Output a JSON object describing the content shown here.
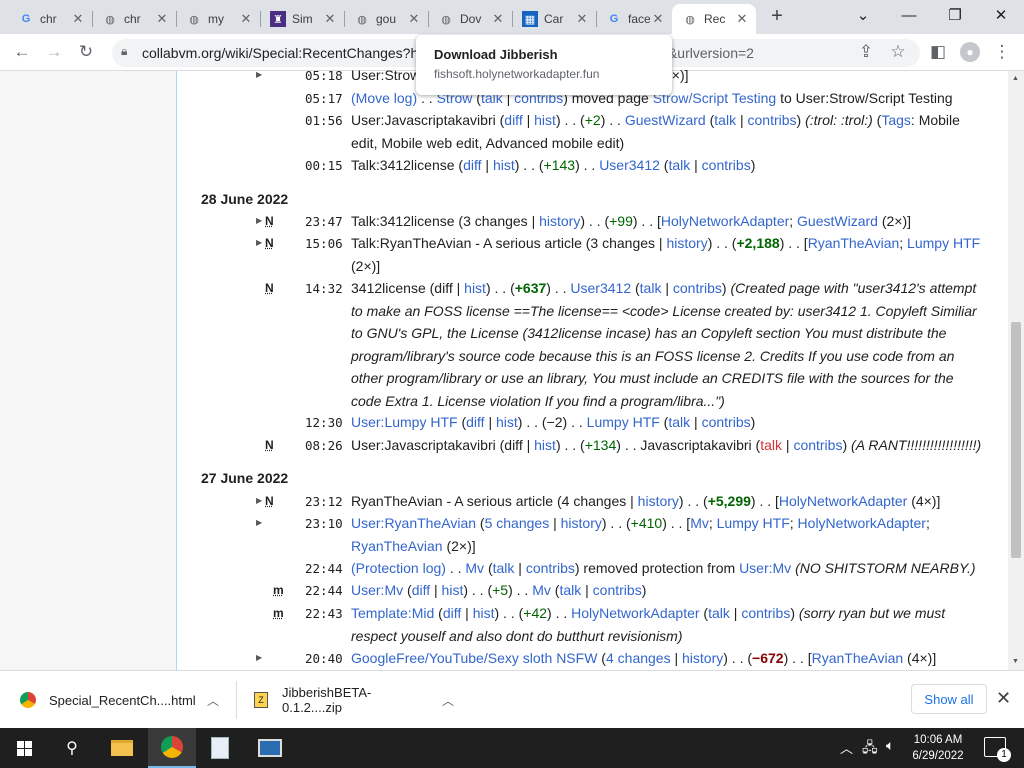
{
  "tabs": [
    {
      "title": "chr",
      "icon": "google-icon"
    },
    {
      "title": "chr",
      "icon": "globe-icon"
    },
    {
      "title": "my",
      "icon": "globe-icon"
    },
    {
      "title": "Sim",
      "icon": "tower-icon"
    },
    {
      "title": "gou",
      "icon": "globe-icon"
    },
    {
      "title": "Dov",
      "icon": "globe-icon"
    },
    {
      "title": "Car",
      "icon": "app-icon"
    },
    {
      "title": "face",
      "icon": "google-icon"
    },
    {
      "title": "Rec",
      "icon": "globe-icon"
    }
  ],
  "address": {
    "url": "collabvm.org/wiki/Special:RecentChanges?hi",
    "url_tail": "=1&urlversion=2"
  },
  "download_popup": {
    "title": "Download Jibberish",
    "source": "fishsoft.holynetworkadapter.fun"
  },
  "days": [
    "28 June 2022",
    "27 June 2022"
  ],
  "rows": {
    "r0": {
      "time": "05:18",
      "p1": "User:Strow",
      "p2": "4×)]"
    },
    "r1": {
      "time": "05:17",
      "log": "(Move log)",
      "sep": " . . ",
      "user": "Strow",
      "talk": "talk",
      "contribs": "contribs",
      "moved": " moved page ",
      "from": "Strow/Script Testing",
      "to_text": " to User:Strow/Script Testing"
    },
    "r2": {
      "time": "01:56",
      "page": "User:Javascriptakavibri",
      "diff": "diff",
      "hist": "hist",
      "delta": "+2",
      "user": "GuestWizard",
      "talk": "talk",
      "contribs": "contribs",
      "summary": "(:trol: :trol:)",
      "tags_label": "Tags",
      "tags": ": Mobile edit, Mobile web edit, Advanced mobile edit)"
    },
    "r3": {
      "time": "00:15",
      "page": "Talk:3412license",
      "diff": "diff",
      "hist": "hist",
      "delta": "+143",
      "user": "User3412",
      "talk": "talk",
      "contribs": "contribs"
    },
    "r4": {
      "flag": "N",
      "time": "23:47",
      "page": "Talk:3412license",
      "changes": "3 changes",
      "history": "history",
      "delta": "+99",
      "u1": "HolyNetworkAdapter",
      "u2": "GuestWizard",
      "count": "(2×)]"
    },
    "r5": {
      "flag": "N",
      "time": "15:06",
      "page": "Talk:RyanTheAvian - A serious article",
      "changes": "3 changes",
      "history": "history",
      "delta": "+2,188",
      "u1": "RyanTheAvian",
      "u2": "Lumpy HTF",
      "count": "(2×)]"
    },
    "r6": {
      "flag": "N",
      "time": "14:32",
      "page": "3412license",
      "diff": "diff",
      "hist": "hist",
      "delta": "+637",
      "user": "User3412",
      "talk": "talk",
      "contribs": "contribs",
      "summary": "(Created page with \"user3412's attempt to make an FOSS license ==The license== <code> License created by: user3412 1. Copyleft Similiar to GNU's GPL, the License (3412license incase) has an Copyleft section You must distribute the program/library's source code because this is an FOSS license 2. Credits If you use code from an other program/library or use an library, You must include an CREDITS file with the sources for the code Extra 1. License violation If you find a program/libra...\")"
    },
    "r7": {
      "time": "12:30",
      "page": "User:Lumpy HTF",
      "diff": "diff",
      "hist": "hist",
      "delta": "−2",
      "user": "Lumpy HTF",
      "talk": "talk",
      "contribs": "contribs"
    },
    "r8": {
      "flag": "N",
      "time": "08:26",
      "page": "User:Javascriptakavibri",
      "diff": "diff",
      "hist": "hist",
      "delta": "+134",
      "user": "Javascriptakavibri",
      "talk": "talk",
      "contribs": "contribs",
      "summary": "(A RANT!!!!!!!!!!!!!!!!!!)"
    },
    "r9": {
      "flag": "N",
      "time": "23:12",
      "page": "RyanTheAvian - A serious article",
      "changes": "4 changes",
      "history": "history",
      "delta": "+5,299",
      "u1": "HolyNetworkAdapter",
      "count": "(4×)]"
    },
    "r10": {
      "time": "23:10",
      "page": "User:RyanTheAvian",
      "changes": "5 changes",
      "history": "history",
      "delta": "+410",
      "u1": "Mv",
      "u2": "Lumpy HTF",
      "u3": "HolyNetworkAdapter",
      "u4": "RyanTheAvian",
      "count": "(2×)]"
    },
    "r11": {
      "time": "22:44",
      "log": "(Protection log)",
      "user": "Mv",
      "talk": "talk",
      "contribs": "contribs",
      "action": " removed protection from ",
      "target": "User:Mv",
      "summary": "(NO SHITSTORM NEARBY.)"
    },
    "r12": {
      "flag": "m",
      "time": "22:44",
      "page": "User:Mv",
      "diff": "diff",
      "hist": "hist",
      "delta": "+5",
      "user": "Mv",
      "talk": "talk",
      "contribs": "contribs"
    },
    "r13": {
      "flag": "m",
      "time": "22:43",
      "page": "Template:Mid",
      "diff": "diff",
      "hist": "hist",
      "delta": "+42",
      "user": "HolyNetworkAdapter",
      "talk": "talk",
      "contribs": "contribs",
      "summary": "(sorry ryan but we must respect youself and also dont do butthurt revisionism)"
    },
    "r14": {
      "time": "20:40",
      "page": "GoogleFree/YouTube/Sexy sloth NSFW",
      "changes": "4 changes",
      "history": "history",
      "delta": "−672",
      "u1": "RyanTheAvian",
      "count": "(4×)]"
    }
  },
  "downloads": [
    {
      "name": "Special_RecentCh....html",
      "icon": "chrome-icon"
    },
    {
      "name": "JibberishBETA-0.1.2....zip",
      "icon": "zip-icon"
    }
  ],
  "show_all": "Show all",
  "taskbar": {
    "time": "10:06 AM",
    "date": "6/29/2022",
    "notifications": "1"
  }
}
